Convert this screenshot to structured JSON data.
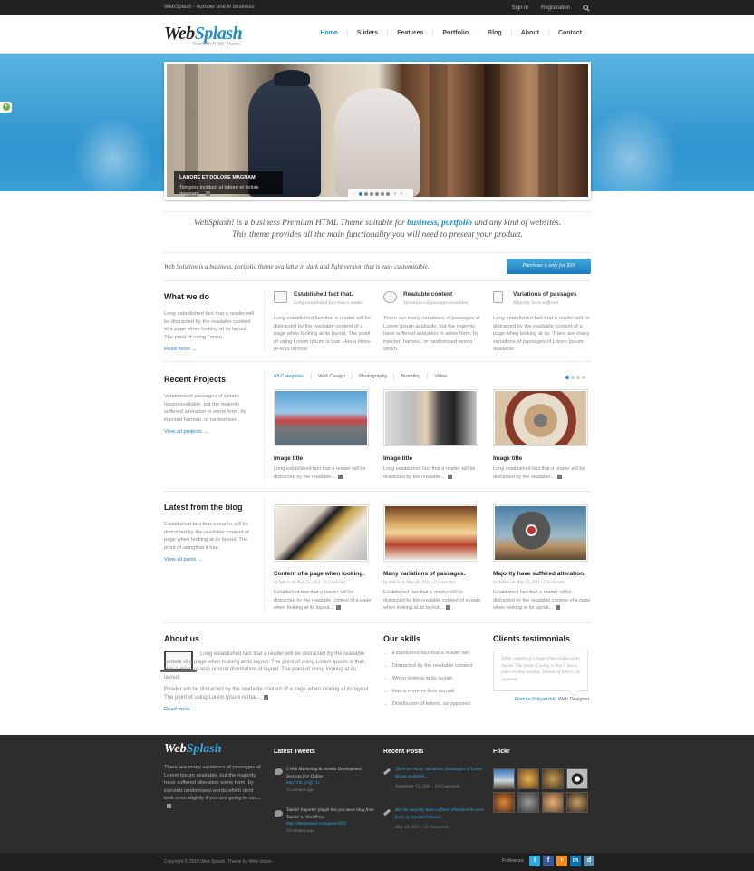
{
  "topbar": {
    "tagline": "WebSplash - number one in business",
    "signin": "Sign in",
    "registration": "Registration"
  },
  "logo": {
    "part1": "Web",
    "part2": "Splash",
    "subtitle": "Premium HTML Theme"
  },
  "nav": [
    "Home",
    "Sliders",
    "Features",
    "Portfolio",
    "Blog",
    "About",
    "Contact"
  ],
  "slider": {
    "caption_title": "LABORE ET DOLORE MAGNAM",
    "caption_text": "Tempora incidunt ut labore et dolore magnam..."
  },
  "intro": {
    "text1": "WebSplash! is a business Premium HTML Theme suitable for ",
    "link": "business, portfolio",
    "text2": " and any kind of websites.",
    "line2": "This theme provides all the main functionality you will need to present your product."
  },
  "promo": {
    "text": "Web Solution is a business, portfolio theme available in dark and light version that is easy customizable.",
    "button": "Purchase it only for $35"
  },
  "whatwedo": {
    "title": "What we do",
    "text": "Long established fact that a reader will be distracted by the readable content of a page when looking at its layout. The point of using Lorem.",
    "link": "Read more →",
    "features": [
      {
        "title": "Established fact that.",
        "sub": "Long established fact that a reader.",
        "text": "Long established fact that a reader will be distracted by the readable content of a page when looking at its layout. The point of using Lorem Ipsum is that. Has a more-or-less normal."
      },
      {
        "title": "Readable content",
        "sub": "Variations of passages available.",
        "text": "There are many variations of passages of Lorem Ipsum available, but the majority have suffered alteration in some form, by injected humour, or randomised words which."
      },
      {
        "title": "Variations of passages",
        "sub": "Majority have suffered.",
        "text": "Long established fact that a reader will be distracted by the readable content of a page when looking at its. There are many variations of passages of Lorem Ipsum available."
      }
    ]
  },
  "projects": {
    "title": "Recent Projects",
    "text": "Variations of passages of Lorem Ipsum available, but the majority suffered alteration in some form, by injected humour, or randomised.",
    "link": "View all projects →",
    "filters": [
      "All Categories",
      "Web Design",
      "Photography",
      "Branding",
      "Video"
    ],
    "items": [
      {
        "title": "Image title",
        "text": "Long established fact that a reader will be distracted by the readable..."
      },
      {
        "title": "Image title",
        "text": "Long established fact that a reader will be distracted by the readable..."
      },
      {
        "title": "Image title",
        "text": "Long established fact that a reader will be distracted by the readable..."
      }
    ]
  },
  "blog": {
    "title": "Latest from the blog",
    "text": "Established fact that a reader will be distracted by the readable content of page when looking at its layout. The point of usingthat it has.",
    "link": "View all posts →",
    "items": [
      {
        "title": "Content of a page when looking.",
        "meta": "by Admin on May 22, 2011 - 2 Comments",
        "text": "Established fact that a reader will be distracted by the readable content of a page when looking at its layout..."
      },
      {
        "title": "Many variations of passages.",
        "meta": "by Admin on May 22, 2011 - 2 Comments",
        "text": "Established fact that a reader will be distracted by the readable content of a page when looking at its layout..."
      },
      {
        "title": "Majority have suffered alteration.",
        "meta": "by Admin on May 22, 2011 - 2 Comments",
        "text": "Established fact that a reader willbe distracted by the readable content of a page when looking at its layout..."
      }
    ]
  },
  "about": {
    "title": "About us",
    "p1": "Long established fact that a reader will be distracted by the readable content of a page when looking at its layout. The point of using Lorem Ipsum is that. Has a more-or-less normal distribution of layout. The point of using looking at its layout.",
    "p2": "Reader will be distracted by the readable content of a page when looking at its layout. The point of using Lorem Ipsum is that...",
    "link": "Read more →"
  },
  "skills": {
    "title": "Our skills",
    "items": [
      "Established fact that a reader will",
      "Distracted by the readable content",
      "When looking at its layout",
      "Has a more-or-less normal",
      "Distribution of letters, as opposed"
    ]
  },
  "testimonials": {
    "title": "Clients testimonials",
    "quote": "Table content of a page when lookin at its layout. The point of using is that it has a more-or-less normal. Details of letters, as opposed.",
    "name": "Roman Polyanzkh,",
    "role": " Web Designer"
  },
  "footer": {
    "about": "There are many variations of passages of Lorem Ipsum available, but the majority have suffered alteration some form, by injected randomised words which dont look even slightly if you are going to use...",
    "tweets_title": "Latest Tweets",
    "tweets": [
      {
        "text": "5 Web Marketing & Joomla Development Services For Online",
        "link": "http://bit.ly/sfyT1s",
        "time": "15 minutes ago"
      },
      {
        "text": "Tumblr Importer plugin lets you move blog from Tumblr to WordPress",
        "link": "http://themedweb.com/pane/2011",
        "time": "20 minutes ago"
      }
    ],
    "posts_title": "Recent Posts",
    "posts": [
      {
        "text": "There are many variations of passages of Lorem Ipsum available...",
        "time": "September 15, 2011 - 10 Comments"
      },
      {
        "text": "But the majority have suffered alteration in some form, by injected humour...",
        "time": "May 18, 2011 - 10 Comments"
      }
    ],
    "flickr_title": "Flickr",
    "copyright": "Copyright © 2010 Web Splash. Theme by Web Vision",
    "follow": "Follow us:"
  },
  "colors": {
    "accent": "#1e8cc7",
    "dark": "#2d2d2d",
    "hero": "#2e93cf"
  }
}
